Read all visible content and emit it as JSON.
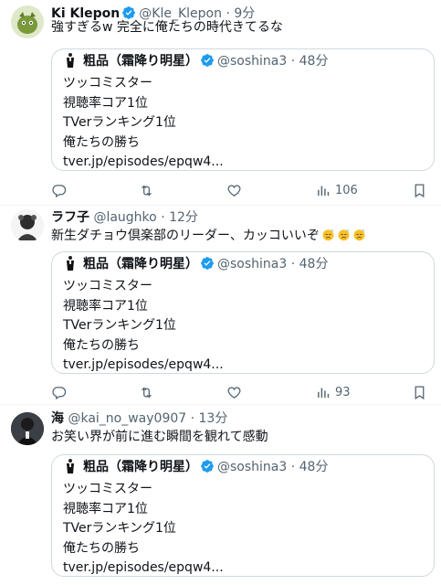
{
  "tweets": [
    {
      "name": "Ki Klepon",
      "handle": "@Kle_Klepon",
      "time": "· 9分",
      "text": "強すぎるw 完全に俺たちの時代きてるな",
      "views": "106",
      "quote": {
        "name": "粗品（霜降り明星）",
        "handle": "@soshina3",
        "time": "· 48分",
        "lines": [
          "ツッコミスター",
          "視聴率コア1位",
          "TVerランキング1位",
          "俺たちの勝ち",
          "tver.jp/episodes/epqw4..."
        ]
      }
    },
    {
      "name": "ラフ子",
      "handle": "@laughko",
      "time": "· 12分",
      "text": "新生ダチョウ倶楽部のリーダー、カッコいいぞ",
      "views": "93",
      "quote": {
        "name": "粗品（霜降り明星）",
        "handle": "@soshina3",
        "time": "· 48分",
        "lines": [
          "ツッコミスター",
          "視聴率コア1位",
          "TVerランキング1位",
          "俺たちの勝ち",
          "tver.jp/episodes/epqw4..."
        ]
      }
    },
    {
      "name": "海",
      "handle": "@kai_no_way0907",
      "time": "· 13分",
      "text": "お笑い界が前に進む瞬間を観れて感動",
      "quote": {
        "name": "粗品（霜降り明星）",
        "handle": "@soshina3",
        "time": "· 48分",
        "lines": [
          "ツッコミスター",
          "視聴率コア1位",
          "TVerランキング1位",
          "俺たちの勝ち",
          "tver.jp/episodes/epqw4..."
        ]
      }
    }
  ],
  "colors": {
    "verified": "#1d9bf0",
    "secondary": "#536471",
    "border": "#cfd9de"
  },
  "icons": [
    "reply-icon",
    "retweet-icon",
    "like-icon",
    "views-icon",
    "bookmark-icon",
    "verified-badge-icon",
    "sweat-emoji-icon"
  ]
}
